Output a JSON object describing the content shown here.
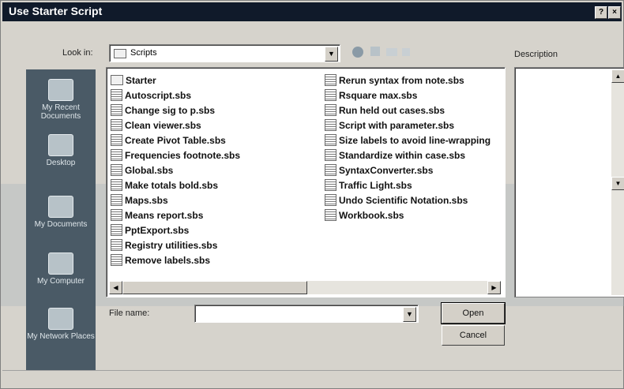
{
  "window": {
    "title": "Use Starter Script",
    "help_btn": "?",
    "close_btn": "×"
  },
  "look_in": {
    "label": "Look in:",
    "value": "Scripts"
  },
  "description": {
    "label": "Description"
  },
  "places": [
    {
      "label": "My Recent Documents",
      "icon": "recent-documents-icon"
    },
    {
      "label": "Desktop",
      "icon": "desktop-icon"
    },
    {
      "label": "My Documents",
      "icon": "my-documents-icon"
    },
    {
      "label": "My Computer",
      "icon": "my-computer-icon"
    },
    {
      "label": "My Network Places",
      "icon": "network-places-icon"
    }
  ],
  "files_col1": [
    {
      "name": "Starter",
      "type": "folder"
    },
    {
      "name": "Autoscript.sbs",
      "type": "file"
    },
    {
      "name": "Change sig to p.sbs",
      "type": "file"
    },
    {
      "name": "Clean viewer.sbs",
      "type": "file"
    },
    {
      "name": "Create Pivot Table.sbs",
      "type": "file"
    },
    {
      "name": "Frequencies footnote.sbs",
      "type": "file"
    },
    {
      "name": "Global.sbs",
      "type": "file"
    },
    {
      "name": "Make totals bold.sbs",
      "type": "file"
    },
    {
      "name": "Maps.sbs",
      "type": "file"
    },
    {
      "name": "Means report.sbs",
      "type": "file"
    },
    {
      "name": "PptExport.sbs",
      "type": "file"
    },
    {
      "name": "Registry utilities.sbs",
      "type": "file"
    },
    {
      "name": "Remove labels.sbs",
      "type": "file"
    }
  ],
  "files_col2": [
    {
      "name": "Rerun syntax from note.sbs",
      "type": "file"
    },
    {
      "name": "Rsquare max.sbs",
      "type": "file"
    },
    {
      "name": "Run held out cases.sbs",
      "type": "file"
    },
    {
      "name": "Script with parameter.sbs",
      "type": "file"
    },
    {
      "name": "Size labels to avoid line-wrapping",
      "type": "file"
    },
    {
      "name": "Standardize within case.sbs",
      "type": "file"
    },
    {
      "name": "SyntaxConverter.sbs",
      "type": "file"
    },
    {
      "name": "Traffic Light.sbs",
      "type": "file"
    },
    {
      "name": "Undo Scientific Notation.sbs",
      "type": "file"
    },
    {
      "name": "Workbook.sbs",
      "type": "file"
    }
  ],
  "file_name": {
    "label": "File name:",
    "value": ""
  },
  "buttons": {
    "open": "Open",
    "cancel": "Cancel"
  },
  "colors": {
    "title_bar": "#101a2a",
    "places_bar": "#4a5a66",
    "dialog_bg": "#d6d3cc"
  }
}
